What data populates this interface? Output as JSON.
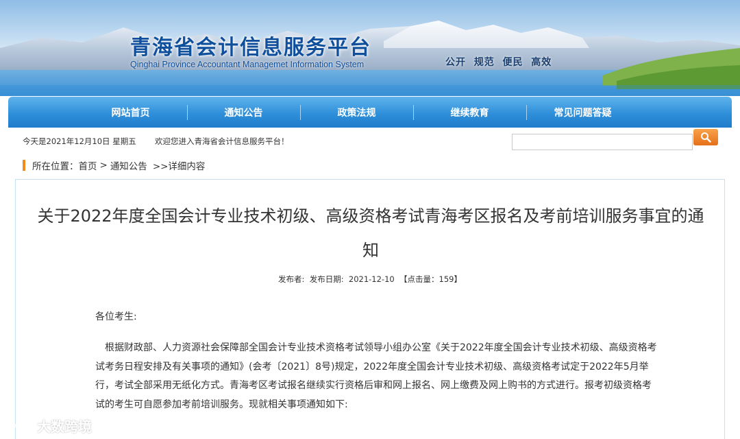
{
  "header": {
    "title": "青海省会计信息服务平台",
    "subtitle": "Qinghai Province Accountant Managemet Information System",
    "slogan": "公开  规范  便民  高效"
  },
  "nav": {
    "items": [
      {
        "label": "网站首页"
      },
      {
        "label": "通知公告"
      },
      {
        "label": "政策法规"
      },
      {
        "label": "继续教育"
      },
      {
        "label": "常见问题答疑"
      }
    ]
  },
  "infobar": {
    "date": "今天是2021年12月10日 星期五",
    "welcome": "欢迎您进入青海省会计信息服务平台！",
    "search_value": "",
    "search_icon": "magnifier-icon"
  },
  "breadcrumb": {
    "prefix": "所在位置：",
    "home": "首页",
    "sep": ">",
    "section": "通知公告",
    "current": ">>详细内容"
  },
  "article": {
    "title": "关于2022年度全国会计专业技术初级、高级资格考试青海考区报名及考前培训服务事宜的通知",
    "meta": "发布者:  发布日期:  2021-12-10  【点击量：159】",
    "greeting": "各位考生:",
    "paragraph": "根据财政部、人力资源社会保障部全国会计专业技术资格考试领导小组办公室《关于2022年度全国会计专业技术初级、高级资格考试考务日程安排及有关事项的通知》(会考〔2021〕8号)规定，2022年度全国会计专业技术初级、高级资格考试定于2022年5月举行，考试全部采用无纸化方式。青海考区考试报名继续实行资格后审和网上报名、网上缴费及网上购书的方式进行。报考初级资格考试的考生可自愿参加考前培训服务。现就相关事项通知如下:"
  },
  "watermark": {
    "text": "大数跨境"
  },
  "colors": {
    "nav_blue": "#2f8fd9",
    "title_blue": "#0f4f9c",
    "accent_orange": "#f08c1e"
  }
}
